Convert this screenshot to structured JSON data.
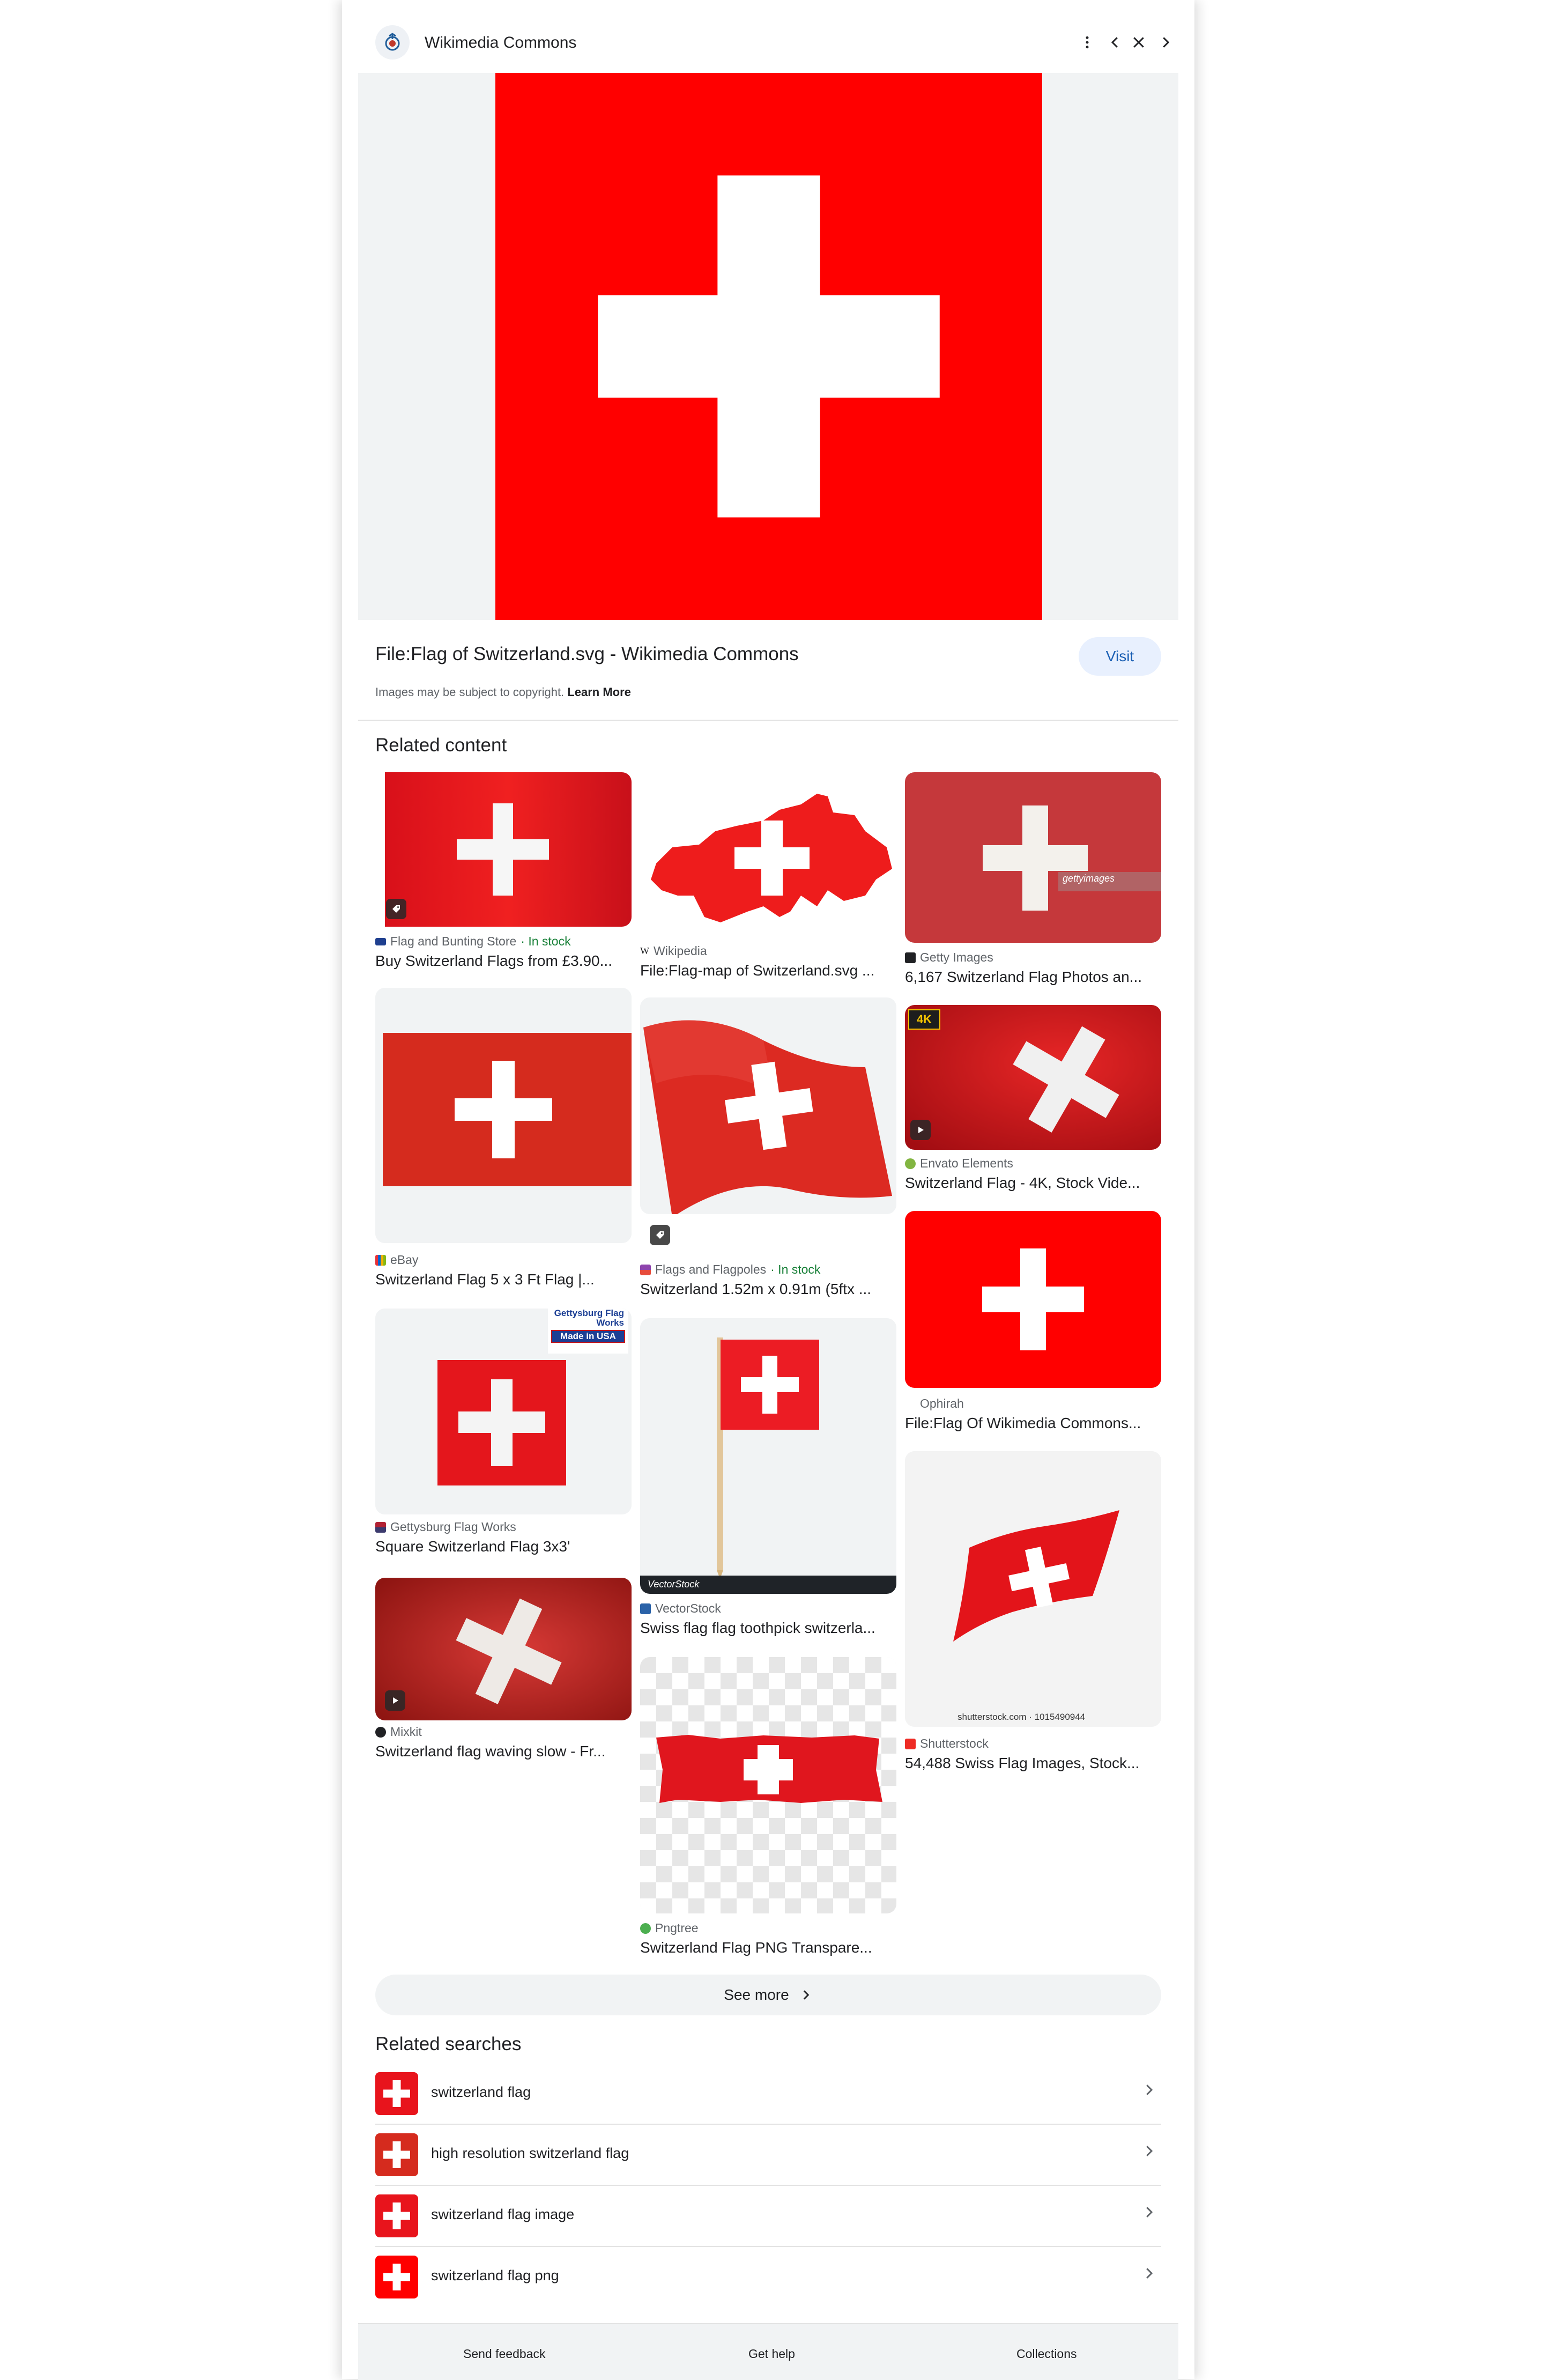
{
  "header": {
    "site_name": "Wikimedia Commons"
  },
  "preview": {
    "title": "File:Flag of Switzerland.svg - Wikimedia Commons",
    "visit_label": "Visit",
    "copyright_text": "Images may be subject to copyright.",
    "learn_more": "Learn More"
  },
  "related_content": {
    "heading": "Related content",
    "items": [
      {
        "source": "Flag and Bunting Store",
        "stock": " · In stock",
        "title": "Buy Switzerland Flags from £3.90..."
      },
      {
        "source": "eBay",
        "title": "Switzerland Flag 5 x 3 Ft Flag |..."
      },
      {
        "source": "Gettysburg Flag Works",
        "title": "Square Switzerland Flag 3x3'"
      },
      {
        "source": "Mixkit",
        "title": "Switzerland flag waving slow - Fr..."
      },
      {
        "source": "Wikipedia",
        "title": "File:Flag-map of Switzerland.svg ..."
      },
      {
        "source": "Flags and Flagpoles",
        "stock": " · In stock",
        "title": "Switzerland 1.52m x 0.91m (5ftx ..."
      },
      {
        "source": "VectorStock",
        "title": "Swiss flag flag toothpick switzerla..."
      },
      {
        "source": "Pngtree",
        "title": "Switzerland Flag PNG Transpare..."
      },
      {
        "source": "Getty Images",
        "title": "6,167 Switzerland Flag Photos an..."
      },
      {
        "source": "Envato Elements",
        "title": "Switzerland Flag - 4K, Stock Vide..."
      },
      {
        "source": "Ophirah",
        "title": "File:Flag Of Wikimedia Commons..."
      },
      {
        "source": "Shutterstock",
        "title": "54,488 Swiss Flag Images, Stock..."
      }
    ],
    "overlay_texts": {
      "gettysburg_logo": "Gettysburg Flag Works",
      "made_in_usa": "Made in USA",
      "getty_watermark": "gettyimages",
      "vectorstock_bar": "VectorStock",
      "badge_4k": "4K",
      "shutterstock_watermark": "shutterstock.com · 1015490944"
    }
  },
  "see_more": "See more",
  "related_searches": {
    "heading": "Related searches",
    "items": [
      {
        "label": "switzerland flag"
      },
      {
        "label": "high resolution switzerland flag"
      },
      {
        "label": "switzerland flag image"
      },
      {
        "label": "switzerland flag png"
      }
    ]
  },
  "footer": {
    "send_feedback": "Send feedback",
    "get_help": "Get help",
    "collections": "Collections"
  },
  "colors": {
    "flag_red": "#ff0000",
    "visit_bg": "#e8f0fe",
    "visit_text": "#1a5fb4",
    "in_stock": "#188038"
  }
}
